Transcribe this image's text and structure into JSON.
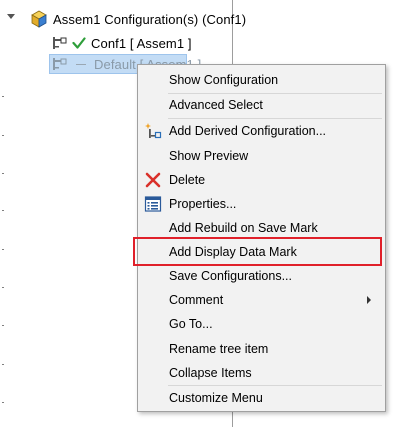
{
  "tree": {
    "root_label": "Assem1 Configuration(s)  (Conf1)",
    "conf1_label": "Conf1 [ Assem1 ]",
    "default_label": "Default [ Assem1 ]"
  },
  "context_menu": {
    "items": [
      {
        "label": "Show Configuration"
      },
      {
        "label": "Advanced Select"
      },
      {
        "label": "Add Derived Configuration..."
      },
      {
        "label": "Show Preview"
      },
      {
        "label": "Delete"
      },
      {
        "label": "Properties..."
      },
      {
        "label": "Add Rebuild on Save Mark"
      },
      {
        "label": "Add Display Data Mark"
      },
      {
        "label": "Save Configurations..."
      },
      {
        "label": "Comment"
      },
      {
        "label": "Go To..."
      },
      {
        "label": "Rename tree item"
      },
      {
        "label": "Collapse Items"
      },
      {
        "label": "Customize Menu"
      }
    ],
    "highlighted_item": "Add Display Data Mark",
    "highlight_color": "#e0202a"
  },
  "icons": {
    "assembly": "assembly-config-icon",
    "config": "configuration-icon",
    "active": "checkmark-icon",
    "derived": "add-derived-config-icon",
    "delete": "delete-x-icon",
    "properties": "properties-icon",
    "submenu": "submenu-arrow-icon"
  },
  "colors": {
    "selection": "#c3dcf5",
    "check": "#2e9e3a",
    "delete": "#d9302a",
    "menu_bg": "#f2f2f2"
  }
}
